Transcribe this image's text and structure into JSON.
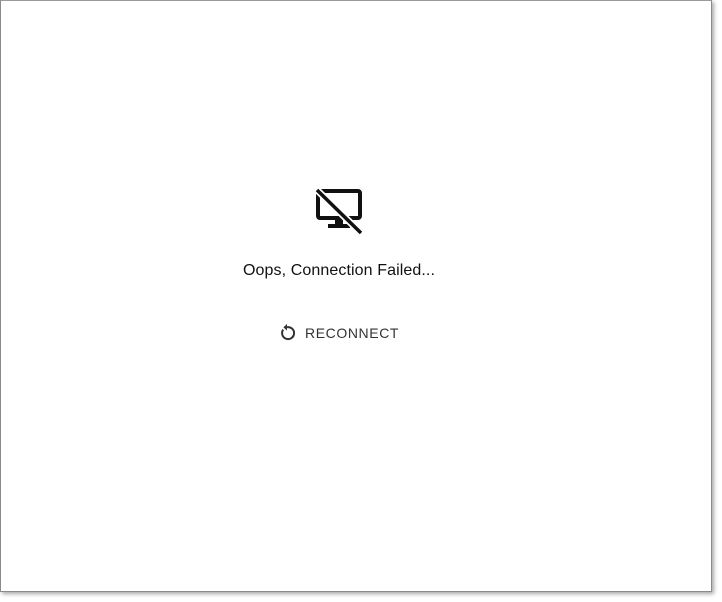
{
  "icons": {
    "status": "monitor-off-icon",
    "reconnect": "refresh-icon"
  },
  "message": {
    "text": "Oops, Connection Failed..."
  },
  "actions": {
    "reconnect_label": "RECONNECT"
  },
  "colors": {
    "icon": "#111111",
    "text": "#111111",
    "button_text": "#333333",
    "background": "#ffffff"
  }
}
